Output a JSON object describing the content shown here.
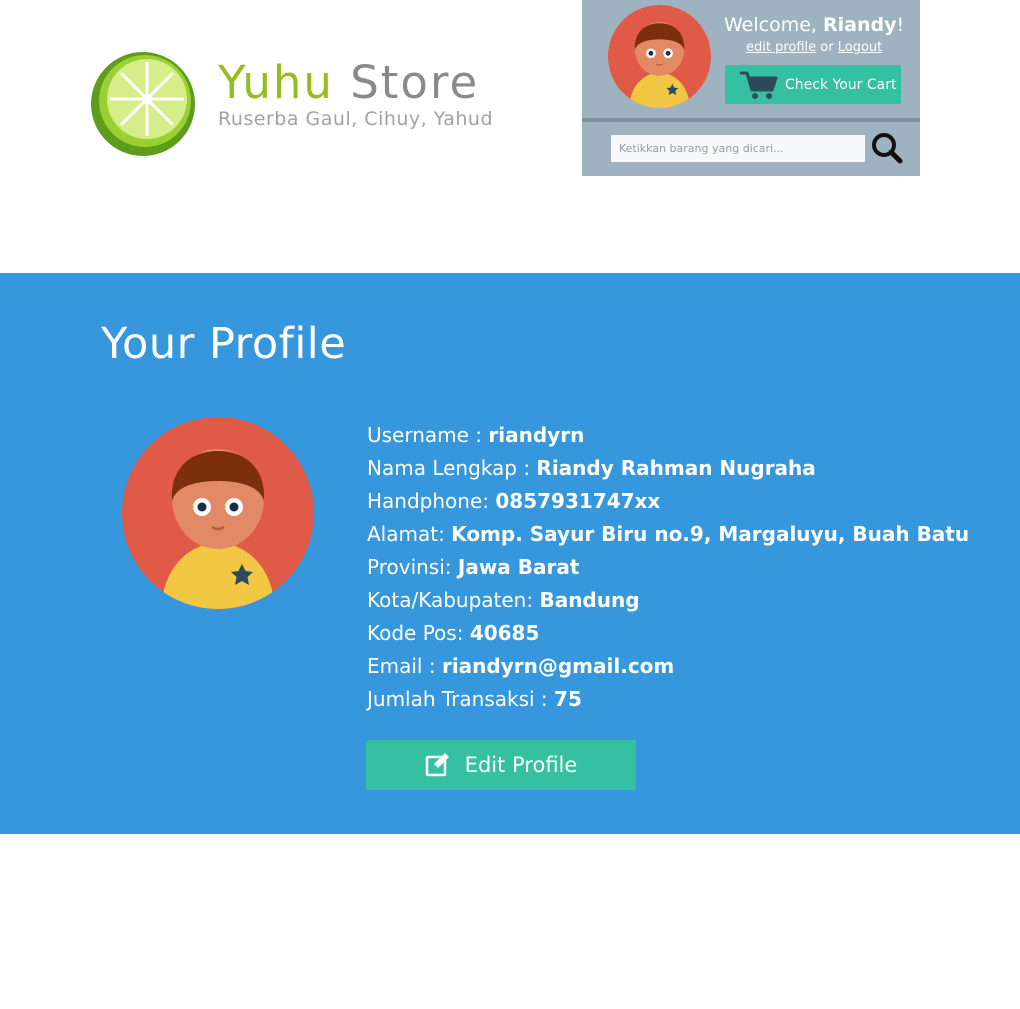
{
  "brand": {
    "name_first": "Yuhu",
    "name_second": "Store",
    "tagline": "Ruserba Gaul, Cihuy, Yahud",
    "logo_icon": "lime-icon"
  },
  "user_panel": {
    "welcome_prefix": "Welcome,",
    "username": "Riandy",
    "welcome_suffix": "!",
    "edit_profile_link": "edit profile",
    "links_separator": "or",
    "logout_link": "Logout",
    "cart_button_label": "Check Your Cart",
    "cart_icon": "shopping-cart-icon",
    "avatar_icon": "user-avatar-icon"
  },
  "search": {
    "placeholder": "Ketikkan barang yang dicari...",
    "value": "",
    "icon": "search-icon"
  },
  "profile": {
    "title": "Your Profile",
    "fields": [
      {
        "label": "Username : ",
        "value": "riandyrn"
      },
      {
        "label": "Nama Lengkap : ",
        "value": "Riandy Rahman Nugraha"
      },
      {
        "label": "Handphone: ",
        "value": "0857931747xx"
      },
      {
        "label": "Alamat: ",
        "value": "Komp. Sayur Biru no.9, Margaluyu, Buah Batu"
      },
      {
        "label": "Provinsi: ",
        "value": "Jawa Barat"
      },
      {
        "label": "Kota/Kabupaten: ",
        "value": "Bandung"
      },
      {
        "label": "Kode Pos: ",
        "value": "40685"
      },
      {
        "label": "Email : ",
        "value": "riandyrn@gmail.com"
      },
      {
        "label": "Jumlah Transaksi  : ",
        "value": "75"
      }
    ],
    "edit_button_label": "Edit Profile",
    "edit_icon": "edit-icon"
  },
  "colors": {
    "brand_green": "#95bd1f",
    "brand_gray": "#8a8a8a",
    "panel_bg": "#9fb2bf",
    "accent_teal": "#35c0a2",
    "section_blue": "#3697dd",
    "avatar_red": "#e05a48",
    "avatar_shirt": "#f2c744"
  }
}
